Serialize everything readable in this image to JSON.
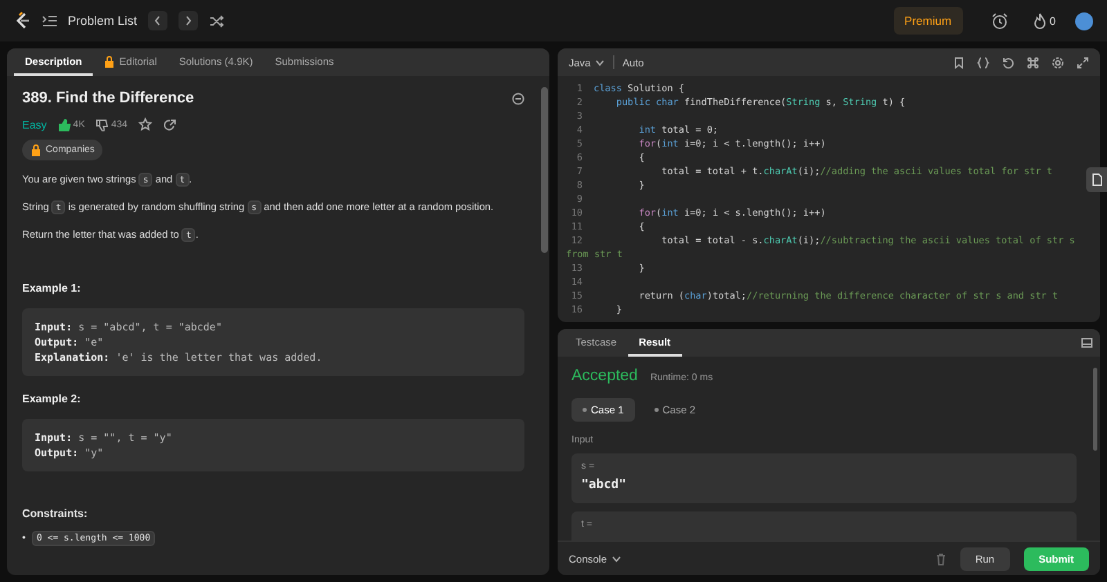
{
  "topbar": {
    "title": "Problem List",
    "premium": "Premium",
    "streak": "0"
  },
  "description_panel": {
    "tabs": [
      {
        "label": "Description",
        "selected": true,
        "locked": false
      },
      {
        "label": "Editorial",
        "selected": false,
        "locked": true
      },
      {
        "label": "Solutions (4.9K)",
        "selected": false,
        "locked": false
      },
      {
        "label": "Submissions",
        "selected": false,
        "locked": false
      }
    ],
    "title": "389. Find the Difference",
    "difficulty": "Easy",
    "likes": "4K",
    "dislikes": "434",
    "companies": "Companies",
    "paragraphs": [
      [
        {
          "kind": "text",
          "text": "You are given two strings "
        },
        {
          "kind": "code",
          "text": "s"
        },
        {
          "kind": "text",
          "text": " and "
        },
        {
          "kind": "code",
          "text": "t"
        },
        {
          "kind": "text",
          "text": "."
        }
      ],
      [
        {
          "kind": "text",
          "text": "String "
        },
        {
          "kind": "code",
          "text": "t"
        },
        {
          "kind": "text",
          "text": " is generated by random shuffling string "
        },
        {
          "kind": "code",
          "text": "s"
        },
        {
          "kind": "text",
          "text": " and then add one more letter at a random position."
        }
      ],
      [
        {
          "kind": "text",
          "text": "Return the letter that was added to "
        },
        {
          "kind": "code",
          "text": "t"
        },
        {
          "kind": "text",
          "text": "."
        }
      ]
    ],
    "examples": [
      {
        "heading": "Example 1:",
        "lines": [
          "**Input:** s = \"abcd\", t = \"abcde\"",
          "**Output:** \"e\"",
          "**Explanation:** 'e' is the letter that was added."
        ]
      },
      {
        "heading": "Example 2:",
        "lines": [
          "**Input:** s = \"\", t = \"y\"",
          "**Output:** \"y\""
        ]
      }
    ],
    "constraints_heading": "Constraints:",
    "constraints": [
      {
        "marker": "•",
        "text": "0 <= s.length <= 1000"
      }
    ]
  },
  "editor": {
    "language": "Java",
    "mode": "Auto",
    "lines": [
      {
        "number": "1",
        "tokens": [
          {
            "kind": "keyword",
            "text": "class"
          },
          {
            "kind": "plain",
            "text": " Solution {"
          }
        ]
      },
      {
        "number": "2",
        "tokens": [
          {
            "kind": "keyword",
            "text": "    public char"
          },
          {
            "kind": "plain",
            "text": " findTheDifference("
          },
          {
            "kind": "type",
            "text": "String"
          },
          {
            "kind": "plain",
            "text": " s, "
          },
          {
            "kind": "type",
            "text": "String"
          },
          {
            "kind": "plain",
            "text": " t) {"
          }
        ]
      },
      {
        "number": "3"
      },
      {
        "number": "4",
        "tokens": [
          {
            "kind": "keyword",
            "text": "        int"
          },
          {
            "kind": "plain",
            "text": " total = 0;"
          }
        ]
      },
      {
        "number": "5",
        "tokens": [
          {
            "kind": "control",
            "text": "        for"
          },
          {
            "kind": "plain",
            "text": "("
          },
          {
            "kind": "keyword",
            "text": "int"
          },
          {
            "kind": "plain",
            "text": " i=0; i < t.length(); i++)"
          }
        ]
      },
      {
        "number": "6",
        "tokens": [
          {
            "kind": "plain",
            "text": "        {"
          }
        ]
      },
      {
        "number": "7",
        "tokens": [
          {
            "kind": "plain",
            "text": "            total = total + t."
          },
          {
            "kind": "method",
            "text": "charAt"
          },
          {
            "kind": "plain",
            "text": "(i);"
          },
          {
            "kind": "comment",
            "text": "//adding the ascii values total for str t"
          }
        ]
      },
      {
        "number": "8",
        "tokens": [
          {
            "kind": "plain",
            "text": "        }"
          }
        ]
      },
      {
        "number": "9"
      },
      {
        "number": "10",
        "tokens": [
          {
            "kind": "control",
            "text": "        for"
          },
          {
            "kind": "plain",
            "text": "("
          },
          {
            "kind": "keyword",
            "text": "int"
          },
          {
            "kind": "plain",
            "text": " i=0; i < s.length(); i++)"
          }
        ]
      },
      {
        "number": "11",
        "tokens": [
          {
            "kind": "plain",
            "text": "        {"
          }
        ]
      },
      {
        "number": "12",
        "tokens": [
          {
            "kind": "plain",
            "text": "            total = total - s."
          },
          {
            "kind": "method",
            "text": "charAt"
          },
          {
            "kind": "plain",
            "text": "(i);"
          },
          {
            "kind": "comment",
            "text": "//subtracting the ascii values total of str s"
          }
        ],
        "wrapped": [
          {
            "kind": "comment",
            "text": "from str t"
          }
        ]
      },
      {
        "number": "13",
        "tokens": [
          {
            "kind": "plain",
            "text": "        }"
          }
        ]
      },
      {
        "number": "14"
      },
      {
        "number": "15",
        "tokens": [
          {
            "kind": "plain",
            "text": "        return ("
          },
          {
            "kind": "keyword",
            "text": "char"
          },
          {
            "kind": "plain",
            "text": ")total;"
          },
          {
            "kind": "comment",
            "text": "//returning the difference character of str s and str t"
          }
        ]
      },
      {
        "number": "16",
        "tokens": [
          {
            "kind": "plain",
            "text": "    }"
          }
        ]
      }
    ]
  },
  "console": {
    "tabs": [
      {
        "label": "Testcase",
        "selected": false
      },
      {
        "label": "Result",
        "selected": true
      }
    ],
    "verdict": "Accepted",
    "runtime": "Runtime: 0 ms",
    "cases": [
      {
        "label": "Case 1",
        "selected": true
      },
      {
        "label": "Case 2",
        "selected": false
      }
    ],
    "input_label": "Input",
    "inputs": [
      {
        "name": "s =",
        "value": "\"abcd\""
      },
      {
        "name": "t ="
      }
    ],
    "console_label": "Console",
    "run": "Run",
    "submit": "Submit"
  }
}
